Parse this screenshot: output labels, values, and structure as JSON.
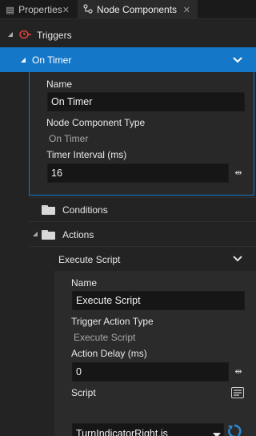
{
  "tabs": [
    {
      "label": "Properties",
      "close": "✕"
    },
    {
      "label": "Node Components",
      "close": "✕"
    }
  ],
  "tree": {
    "triggers_label": "Triggers",
    "on_timer": {
      "header": "On Timer",
      "name_label": "Name",
      "name_value": "On Timer",
      "type_label": "Node Component Type",
      "type_value": "On Timer",
      "interval_label": "Timer Interval (ms)",
      "interval_value": "16"
    },
    "conditions_label": "Conditions",
    "actions_label": "Actions",
    "execute_script": {
      "header": "Execute Script",
      "name_label": "Name",
      "name_value": "Execute Script",
      "type_label": "Trigger Action Type",
      "type_value": "Execute Script",
      "delay_label": "Action Delay (ms)",
      "delay_value": "0",
      "script_label": "Script",
      "script_value": "TurnIndicatorRight.js"
    }
  },
  "colors": {
    "selection": "#1577c7",
    "accent_blue": "#2c8bd6",
    "trigger_red": "#e0453a"
  }
}
